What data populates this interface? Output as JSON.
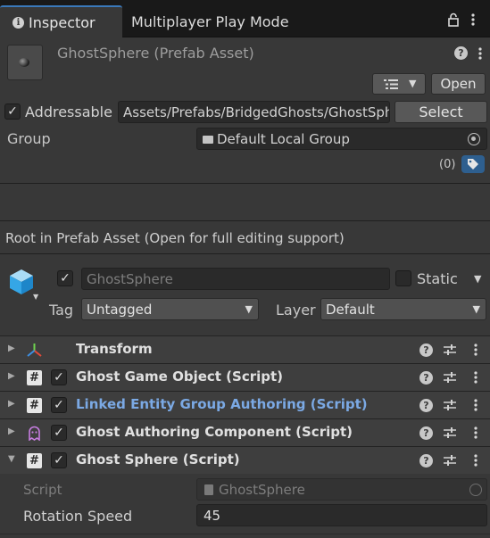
{
  "tabs": {
    "inspector": "Inspector",
    "multiplayer": "Multiplayer Play Mode"
  },
  "header": {
    "title": "GhostSphere (Prefab Asset)",
    "open_label": "Open"
  },
  "addressable": {
    "checked": true,
    "label": "Addressable",
    "path": "Assets/Prefabs/BridgedGhosts/GhostSphere.prefab",
    "select_label": "Select",
    "group_label": "Group",
    "group_value": "Default Local Group",
    "label_count": "(0)"
  },
  "root_message": "Root in Prefab Asset (Open for full editing support)",
  "gameobject": {
    "active": true,
    "name": "GhostSphere",
    "static_label": "Static",
    "static_checked": false,
    "tag_label": "Tag",
    "tag_value": "Untagged",
    "layer_label": "Layer",
    "layer_value": "Default"
  },
  "components": [
    {
      "name": "Transform",
      "icon": "transform-icon",
      "expanded": false
    },
    {
      "name": "Ghost Game Object (Script)",
      "icon": "script-icon",
      "enabled": true,
      "expanded": false
    },
    {
      "name": "Linked Entity Group Authoring (Script)",
      "icon": "script-icon",
      "enabled": true,
      "expanded": false,
      "color": "#7ba9e4"
    },
    {
      "name": "Ghost Authoring Component (Script)",
      "icon": "ghost-icon",
      "enabled": true,
      "expanded": false
    },
    {
      "name": "Ghost Sphere (Script)",
      "icon": "script-icon",
      "enabled": true,
      "expanded": true
    }
  ],
  "ghost_sphere": {
    "script_label": "Script",
    "script_value": "GhostSphere",
    "rotation_label": "Rotation Speed",
    "rotation_value": "45"
  },
  "colors": {
    "background": "#383838",
    "accent": "#3a79bb",
    "label_button": "#2e5f8f"
  }
}
